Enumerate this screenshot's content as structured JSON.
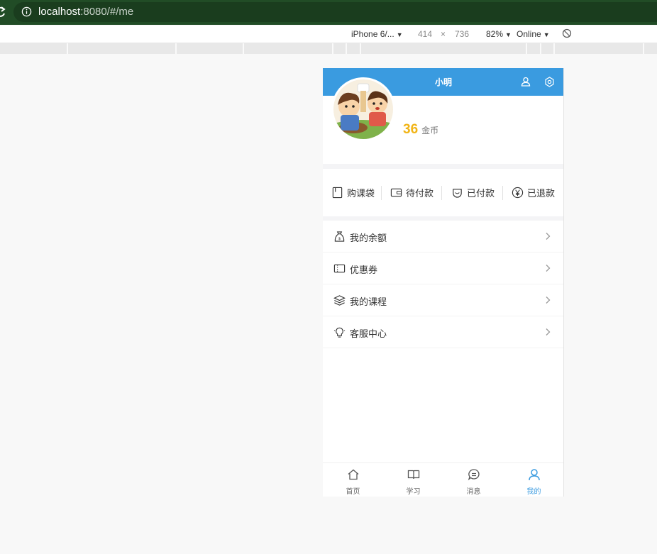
{
  "browser": {
    "url_host": "localhost",
    "url_rest": ":8080/#/me",
    "device": "iPhone 6/...",
    "width": "414",
    "times": "×",
    "height": "736",
    "zoom": "82%",
    "network": "Online"
  },
  "colors": {
    "header_blue": "#3a9be0",
    "coin_yellow": "#f1b416",
    "chrome_green": "#214c26"
  },
  "app": {
    "username": "小明",
    "coins": {
      "value": "36",
      "unit": "金币"
    },
    "orders": [
      {
        "label": "购课袋",
        "icon": "book-icon"
      },
      {
        "label": "待付款",
        "icon": "wallet-icon"
      },
      {
        "label": "已付款",
        "icon": "paid-icon"
      },
      {
        "label": "已退款",
        "icon": "yen-circle-icon"
      }
    ],
    "menu": [
      {
        "label": "我的余额",
        "icon": "money-bag-icon"
      },
      {
        "label": "优惠券",
        "icon": "ticket-icon"
      },
      {
        "label": "我的课程",
        "icon": "stack-icon"
      },
      {
        "label": "客服中心",
        "icon": "lightbulb-icon"
      }
    ],
    "tabs": [
      {
        "label": "首页",
        "icon": "home-icon",
        "active": false
      },
      {
        "label": "学习",
        "icon": "open-book-icon",
        "active": false
      },
      {
        "label": "消息",
        "icon": "chat-icon",
        "active": false
      },
      {
        "label": "我的",
        "icon": "person-icon",
        "active": true
      }
    ]
  }
}
